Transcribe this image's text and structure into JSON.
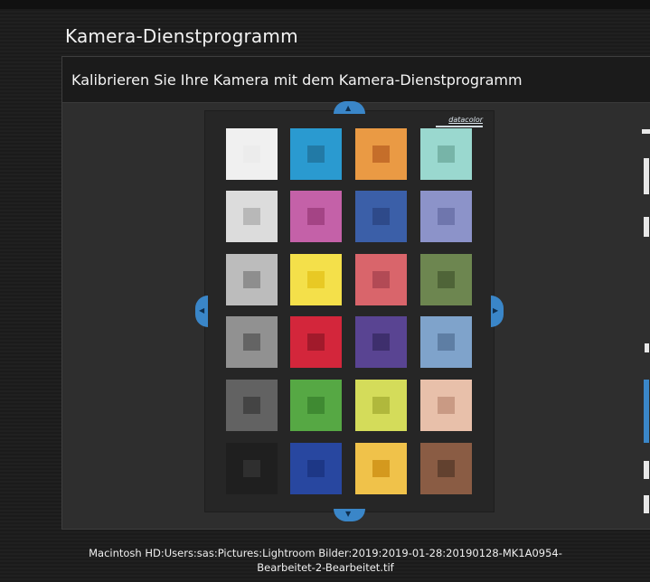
{
  "app": {
    "title": "Kamera-Dienstprogramm"
  },
  "panel": {
    "title": "Kalibrieren Sie Ihre Kamera mit dem Kamera-Dienstprogramm"
  },
  "chart_image": {
    "brand": "datacolor",
    "rows": [
      [
        {
          "outer": "#f0f0f0",
          "inner": "#ececec"
        },
        {
          "outer": "#2a9ad0",
          "inner": "#227aa6"
        },
        {
          "outer": "#ea9a44",
          "inner": "#c56e2a"
        },
        {
          "outer": "#9ad8cf",
          "inner": "#77b4a8"
        }
      ],
      [
        {
          "outer": "#dcdcdc",
          "inner": "#b8b8b8"
        },
        {
          "outer": "#c461a8",
          "inner": "#a44485"
        },
        {
          "outer": "#3b5fa8",
          "inner": "#2e4a8a"
        },
        {
          "outer": "#8c93c9",
          "inner": "#6f76ad"
        }
      ],
      [
        {
          "outer": "#bcbcbc",
          "inner": "#8e8e8e"
        },
        {
          "outer": "#f4e04a",
          "inner": "#e8c924"
        },
        {
          "outer": "#d9656b",
          "inner": "#b24a55"
        },
        {
          "outer": "#6d8650",
          "inner": "#4f6438"
        }
      ],
      [
        {
          "outer": "#919191",
          "inner": "#646464"
        },
        {
          "outer": "#d3263b",
          "inner": "#a11a2b"
        },
        {
          "outer": "#594492",
          "inner": "#3e2f6d"
        },
        {
          "outer": "#7fa3cb",
          "inner": "#5e7ea4"
        }
      ],
      [
        {
          "outer": "#626262",
          "inner": "#444444"
        },
        {
          "outer": "#56a844",
          "inner": "#3f8a32"
        },
        {
          "outer": "#d4dc5a",
          "inner": "#b0b83c"
        },
        {
          "outer": "#e8c0aa",
          "inner": "#c99a84"
        }
      ],
      [
        {
          "outer": "#1f1f1f",
          "inner": "#2f2f2f"
        },
        {
          "outer": "#2847a0",
          "inner": "#1d3786"
        },
        {
          "outer": "#f0c24a",
          "inner": "#d4991e"
        },
        {
          "outer": "#8a5c44",
          "inner": "#62412f"
        }
      ]
    ]
  },
  "footer": {
    "path_line1": "Macintosh HD:Users:sas:Pictures:Lightroom Bilder:2019:2019-01-28:20190128-MK1A0954-",
    "path_line2": "Bearbeitet-2-Bearbeitet.tif"
  }
}
